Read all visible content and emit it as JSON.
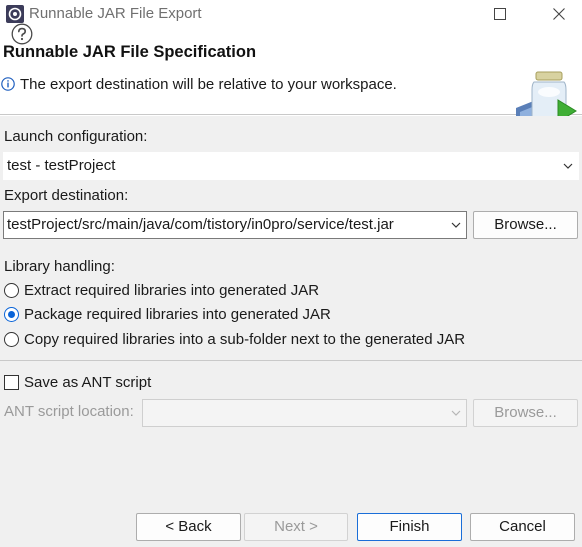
{
  "window": {
    "title": "Runnable JAR File Export"
  },
  "banner": {
    "title": "Runnable JAR File Specification",
    "message": "The export destination will be relative to your workspace."
  },
  "launch": {
    "label": "Launch configuration:",
    "value": "test - testProject"
  },
  "export": {
    "label": "Export destination:",
    "value": "testProject/src/main/java/com/tistory/in0pro/service/test.jar",
    "browse_label": "Browse..."
  },
  "library": {
    "label": "Library handling:",
    "options": [
      {
        "label": "Extract required libraries into generated JAR",
        "selected": false
      },
      {
        "label": "Package required libraries into generated JAR",
        "selected": true
      },
      {
        "label": "Copy required libraries into a sub-folder next to the generated JAR",
        "selected": false
      }
    ]
  },
  "ant": {
    "checkbox_label": "Save as ANT script",
    "checked": false,
    "location_label": "ANT script location:",
    "location_value": "",
    "browse_label": "Browse..."
  },
  "footer": {
    "back_label": "< Back",
    "next_label": "Next >",
    "finish_label": "Finish",
    "cancel_label": "Cancel"
  },
  "colors": {
    "accent": "#0a64d8",
    "default_button_border": "#1a6ed8",
    "dialog_background": "#f0f0f0"
  }
}
